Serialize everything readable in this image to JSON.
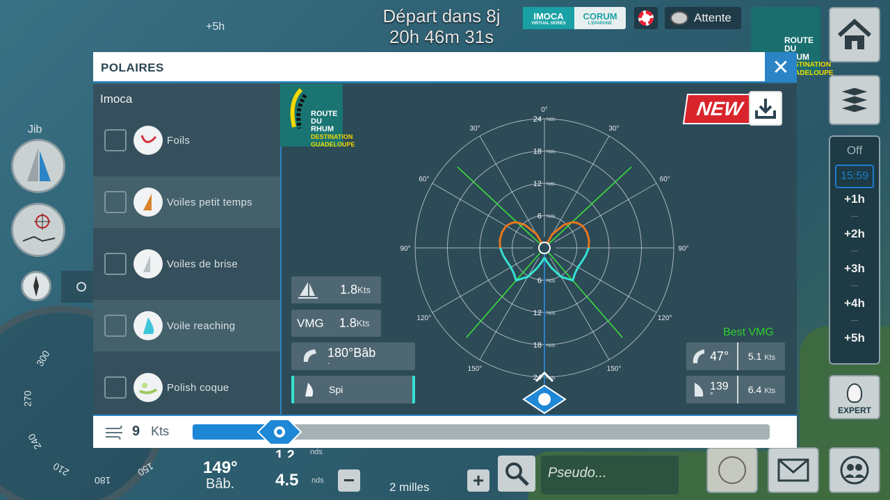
{
  "top": {
    "countdown_line1": "Départ dans 8j",
    "countdown_line2": "20h 46m 31s",
    "imoca_label": "IMOCA",
    "imoca_sub": "VIRTUAL SERIES",
    "corum_label": "CORUM",
    "corum_sub": "L'EPARGNE",
    "status": "Attente",
    "race_logo_line1": "ROUTE",
    "race_logo_line2": "DU RHUM",
    "race_logo_line3": "DESTINATION",
    "race_logo_line4": "GUADELOUPE"
  },
  "background": {
    "sail_label": "Jib",
    "map_time_label": "+5h",
    "heading_value": "149°",
    "heading_side": "Bâb.",
    "speed_value": "1.2",
    "speed_unit": "nds",
    "wind_value": "4.5",
    "wind_unit": "nds",
    "scale_label": "2 milles",
    "pseudo_placeholder": "Pseudo...",
    "compass_labels": [
      "300",
      "270",
      "240",
      "210",
      "180",
      "150"
    ]
  },
  "timebar": {
    "off": "Off",
    "selected": "15:59",
    "items": [
      "+1h",
      "+2h",
      "+3h",
      "+4h",
      "+5h"
    ]
  },
  "expert_label": "EXPERT",
  "modal": {
    "title": "POLAIRES",
    "boat": "Imoca",
    "options": [
      {
        "label": "Foils",
        "icon": "foils-icon",
        "color": "#d22f3a"
      },
      {
        "label": "Voiles petit temps",
        "icon": "light-sails-icon",
        "color": "#d9822b"
      },
      {
        "label": "Voiles de brise",
        "icon": "heavy-sails-icon",
        "color": "#9aa4a8"
      },
      {
        "label": "Voile reaching",
        "icon": "reaching-sail-icon",
        "color": "#3cc6d8"
      },
      {
        "label": "Polish coque",
        "icon": "hull-polish-icon",
        "color": "#bde08a"
      }
    ],
    "new_label": "NEW",
    "stats": {
      "boat_speed": "1.8",
      "boat_speed_unit": "Kts",
      "vmg_label": "VMG",
      "vmg_value": "1.8",
      "vmg_unit": "Kts",
      "twa": "180°Bâb",
      "twa_sub": ".",
      "sail": "Spi"
    },
    "best_vmg_label": "Best VMG",
    "best_vmg": [
      {
        "angle": "47°",
        "speed": "5.1",
        "unit": "Kts"
      },
      {
        "angle": "139",
        "angle_sub": "°",
        "speed": "6.4",
        "unit": "Kts"
      }
    ],
    "wind_speed": "9",
    "wind_unit": "Kts",
    "wind_slider_fraction": 0.15
  },
  "chart_data": {
    "type": "polar",
    "angle_labels": [
      "0°",
      "30°",
      "60°",
      "90°",
      "120°",
      "150°",
      "30°",
      "60°",
      "90°",
      "120°",
      "150°"
    ],
    "radial_ticks": [
      6,
      12,
      18,
      24
    ],
    "radial_unit": "Nds",
    "rmax": 24,
    "current_twa": 180,
    "vmg_lines_deg": [
      47,
      139
    ],
    "colors": {
      "upwind": "#e8771e",
      "downwind": "#36e2d3",
      "vmg": "#3be03b",
      "heading": "#2a84c6",
      "grid": "#c9d3d7"
    },
    "polar": {
      "twa": [
        0,
        30,
        40,
        47,
        52,
        60,
        70,
        80,
        90,
        100,
        110,
        120,
        130,
        139,
        150,
        160,
        170,
        180
      ],
      "speed": [
        0,
        3.0,
        5.5,
        7.0,
        7.6,
        8.2,
        8.4,
        8.4,
        8.2,
        7.8,
        7.4,
        7.2,
        7.4,
        8.0,
        6.2,
        4.0,
        2.6,
        1.8
      ]
    }
  }
}
